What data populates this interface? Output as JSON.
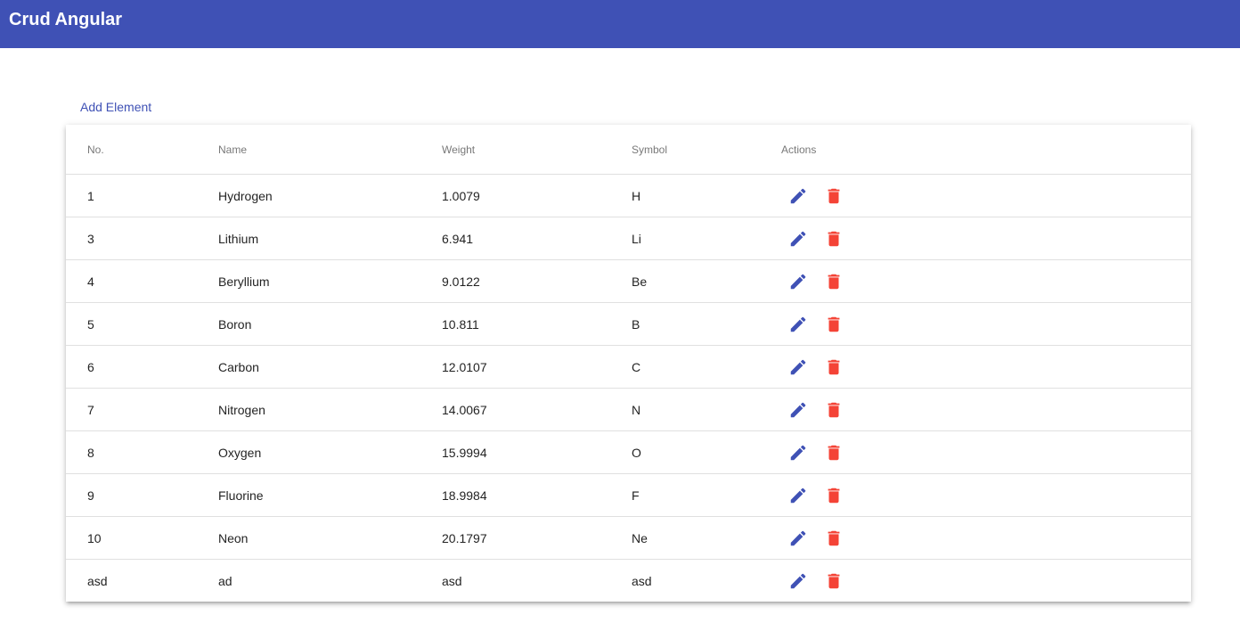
{
  "app": {
    "title": "Crud Angular",
    "primary_color": "#3f51b5",
    "danger_color": "#f44336"
  },
  "actions": {
    "add_label": "Add Element"
  },
  "table": {
    "headers": {
      "no": "No.",
      "name": "Name",
      "weight": "Weight",
      "symbol": "Symbol",
      "actions": "Actions"
    },
    "rows": [
      {
        "no": "1",
        "name": "Hydrogen",
        "weight": "1.0079",
        "symbol": "H"
      },
      {
        "no": "3",
        "name": "Lithium",
        "weight": "6.941",
        "symbol": "Li"
      },
      {
        "no": "4",
        "name": "Beryllium",
        "weight": "9.0122",
        "symbol": "Be"
      },
      {
        "no": "5",
        "name": "Boron",
        "weight": "10.811",
        "symbol": "B"
      },
      {
        "no": "6",
        "name": "Carbon",
        "weight": "12.0107",
        "symbol": "C"
      },
      {
        "no": "7",
        "name": "Nitrogen",
        "weight": "14.0067",
        "symbol": "N"
      },
      {
        "no": "8",
        "name": "Oxygen",
        "weight": "15.9994",
        "symbol": "O"
      },
      {
        "no": "9",
        "name": "Fluorine",
        "weight": "18.9984",
        "symbol": "F"
      },
      {
        "no": "10",
        "name": "Neon",
        "weight": "20.1797",
        "symbol": "Ne"
      },
      {
        "no": "asd",
        "name": "ad",
        "weight": "asd",
        "symbol": "asd"
      }
    ],
    "row_icons": {
      "edit": "pencil-icon",
      "delete": "trash-icon"
    }
  }
}
